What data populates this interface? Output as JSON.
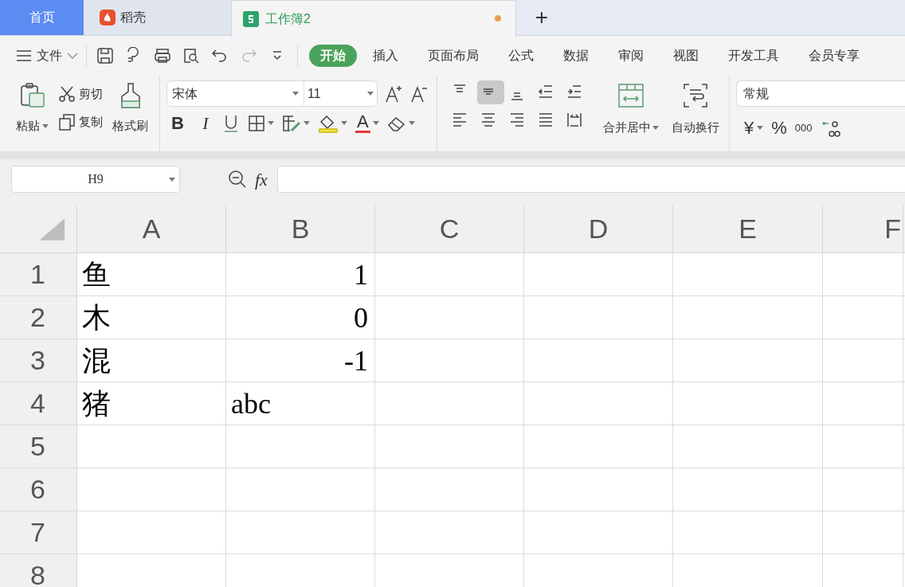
{
  "tabs": [
    {
      "label": "首页",
      "kind": "home",
      "selected": false
    },
    {
      "label": "稻壳",
      "kind": "docer",
      "selected": false
    },
    {
      "label": "工作簿2",
      "kind": "sheet",
      "selected": true,
      "unsaved": true
    }
  ],
  "new_tab": "+",
  "menu": {
    "file": "文件",
    "items": [
      {
        "label": "开始",
        "selected": true
      },
      {
        "label": "插入",
        "selected": false
      },
      {
        "label": "页面布局",
        "selected": false
      },
      {
        "label": "公式",
        "selected": false
      },
      {
        "label": "数据",
        "selected": false
      },
      {
        "label": "审阅",
        "selected": false
      },
      {
        "label": "视图",
        "selected": false
      },
      {
        "label": "开发工具",
        "selected": false
      },
      {
        "label": "会员专享",
        "selected": false
      }
    ]
  },
  "ribbon": {
    "paste": "粘贴",
    "cut": "剪切",
    "copy": "复制",
    "format_painter": "格式刷",
    "font_name": "宋体",
    "font_size": "11",
    "bold": "B",
    "italic": "I",
    "font_color": "A",
    "align_top": [
      {
        "kind": "top",
        "selected": false
      },
      {
        "kind": "middle",
        "selected": true
      },
      {
        "kind": "bottom",
        "selected": false
      },
      {
        "kind": "outdent",
        "selected": false
      },
      {
        "kind": "indent",
        "selected": false
      }
    ],
    "merge": "合并居中",
    "wrap": "自动换行",
    "number_format": "常规",
    "currency": "¥",
    "percent": "%",
    "thousands": "000"
  },
  "formula_bar": {
    "name_box": "H9",
    "fx": "fx"
  },
  "sheet": {
    "columns": [
      "A",
      "B",
      "C",
      "D",
      "E",
      "F"
    ],
    "rows": [
      {
        "header": "1",
        "cells": [
          {
            "text": "鱼",
            "kind": "text"
          },
          {
            "text": "1",
            "kind": "number"
          }
        ]
      },
      {
        "header": "2",
        "cells": [
          {
            "text": "木",
            "kind": "text"
          },
          {
            "text": "0",
            "kind": "number"
          }
        ]
      },
      {
        "header": "3",
        "cells": [
          {
            "text": "混",
            "kind": "text"
          },
          {
            "text": "-1",
            "kind": "number"
          }
        ]
      },
      {
        "header": "4",
        "cells": [
          {
            "text": "猪",
            "kind": "text"
          },
          {
            "text": "abc",
            "kind": "text"
          }
        ]
      },
      {
        "header": "5",
        "cells": []
      },
      {
        "header": "6",
        "cells": []
      },
      {
        "header": "7",
        "cells": []
      },
      {
        "header": "8",
        "cells": []
      }
    ]
  }
}
